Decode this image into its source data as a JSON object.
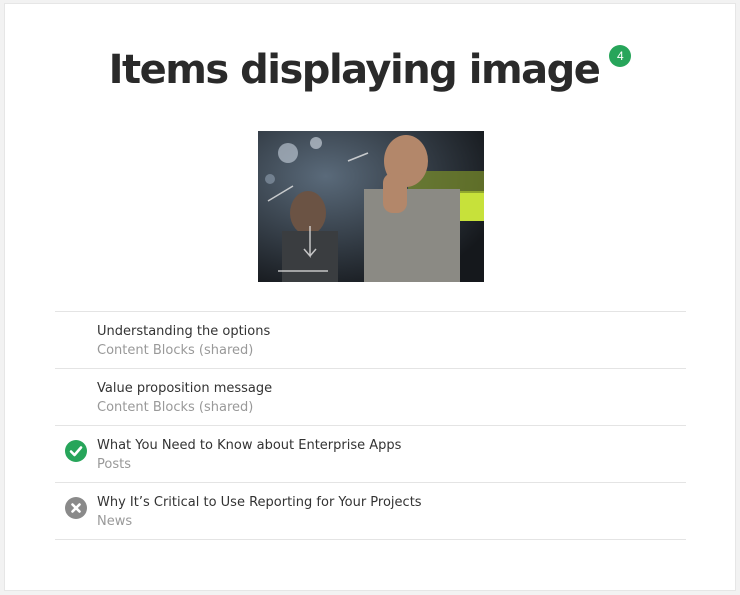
{
  "heading": {
    "title": "Items displaying image",
    "count": "4"
  },
  "items": [
    {
      "title": "Understanding the options",
      "type": "Content Blocks (shared)",
      "status": "none"
    },
    {
      "title": "Value proposition message",
      "type": "Content Blocks (shared)",
      "status": "none"
    },
    {
      "title": "What You Need to Know about Enterprise Apps",
      "type": "Posts",
      "status": "check-icon"
    },
    {
      "title": "Why It’s Critical to Use Reporting for Your Projects",
      "type": "News",
      "status": "close-icon"
    }
  ],
  "colors": {
    "badge": "#27a55a",
    "check": "#27a55a",
    "cross": "#8a8a8a"
  }
}
